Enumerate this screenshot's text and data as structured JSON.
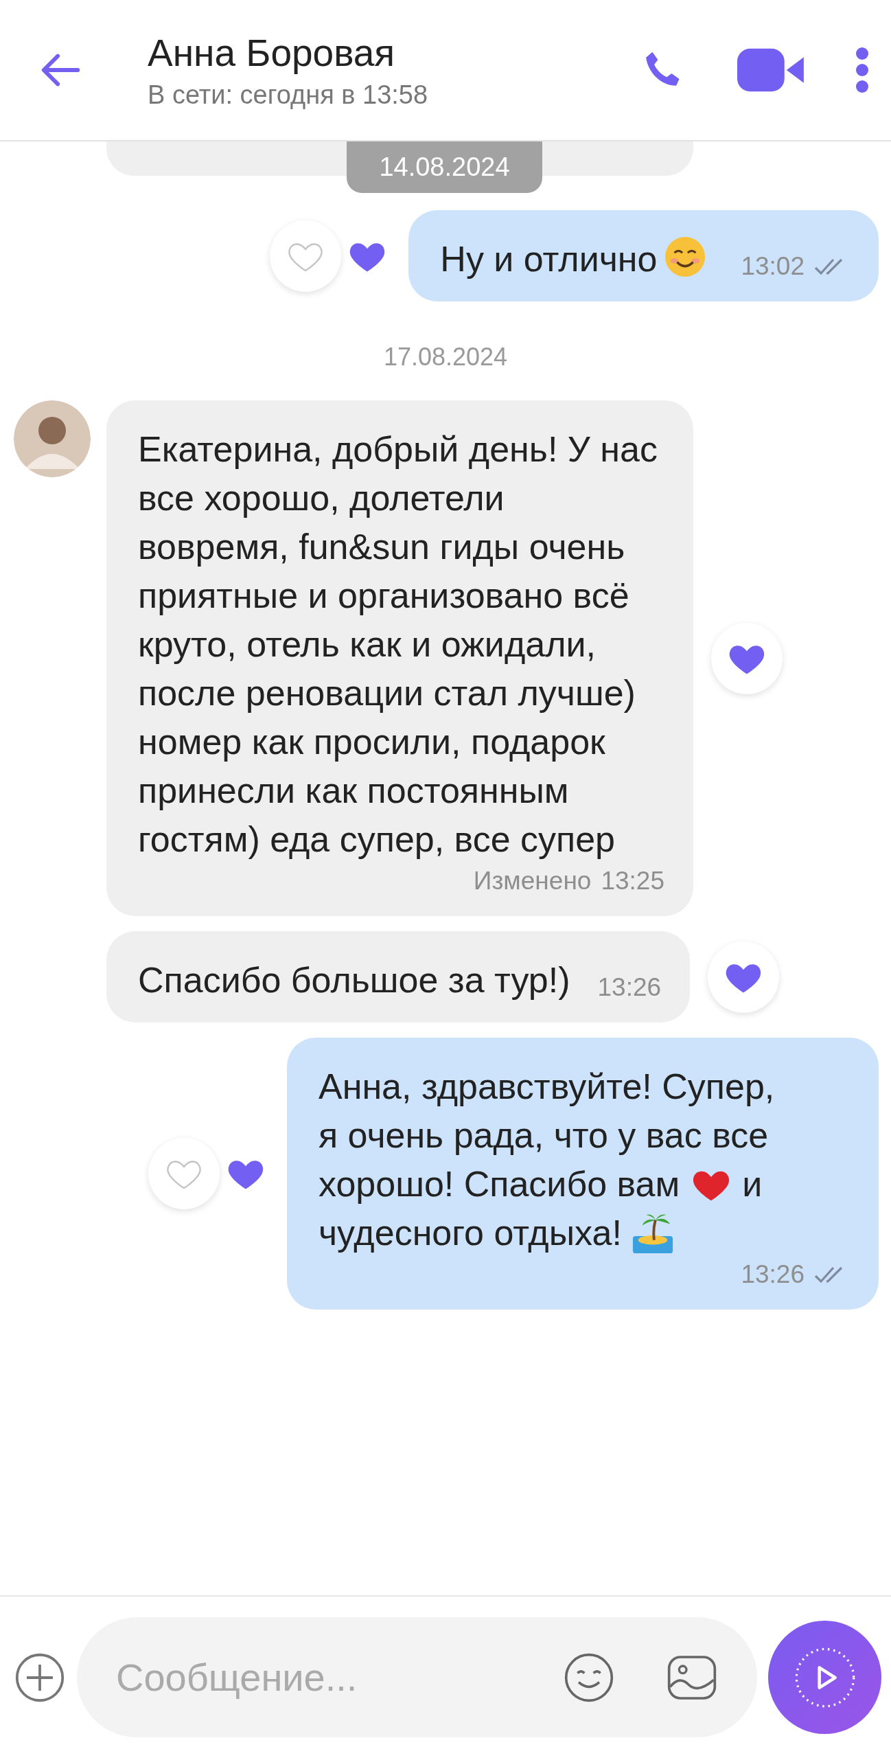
{
  "header": {
    "name": "Анна Боровая",
    "status": "В сети: сегодня в 13:58"
  },
  "pinned_date": "14.08.2024",
  "messages": [
    {
      "kind": "out",
      "parts": [
        {
          "kind": "text",
          "text": "Ну и отлично"
        },
        {
          "kind": "smile"
        }
      ],
      "time": "13:02",
      "read": true,
      "reaction": {
        "liked": true
      }
    },
    {
      "kind": "date",
      "text": "17.08.2024"
    },
    {
      "kind": "in",
      "avatar": true,
      "parts": [
        {
          "kind": "text",
          "text": "Екатерина, добрый день! У нас все хорошо, долетели вовремя, fun&sun гиды очень приятные и организовано всё круто, отель как и ожидали, после реновации стал лучше) номер как просили, подарок принесли как постоянным гостям) еда супер, все супер"
        }
      ],
      "edited": "Изменено",
      "time": "13:25",
      "reaction": {
        "liked": true
      }
    },
    {
      "kind": "in",
      "avatar": false,
      "parts": [
        {
          "kind": "text",
          "text": "Спасибо большое за тур!)"
        }
      ],
      "time": "13:26",
      "reaction": {
        "liked": true
      }
    },
    {
      "kind": "out",
      "parts": [
        {
          "kind": "text",
          "text": "Анна, здравствуйте! Супер,"
        },
        {
          "kind": "text",
          "text": "я очень рада, что у вас все"
        },
        {
          "kind": "text",
          "text": "хорошо! Спасибо вам"
        },
        {
          "kind": "heart"
        },
        {
          "kind": "text",
          "text": "и"
        },
        {
          "kind": "text",
          "text": "чудесного отдыха!"
        },
        {
          "kind": "island"
        }
      ],
      "time": "13:26",
      "read": true,
      "reaction": {
        "liked": true
      }
    }
  ],
  "composer": {
    "placeholder": "Сообщение..."
  }
}
